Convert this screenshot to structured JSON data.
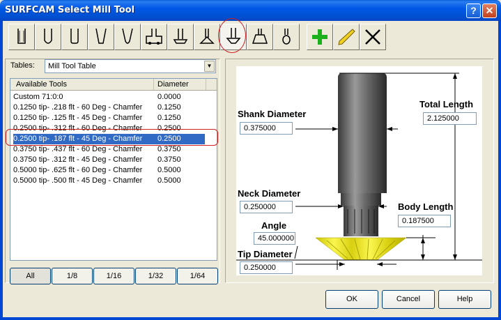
{
  "window": {
    "title": "SURFCAM Select Mill Tool",
    "help_glyph": "?",
    "close_glyph": "✕"
  },
  "toolbar": {
    "tools": [
      "flat-end-mill-icon",
      "ball-end-mill-icon",
      "bull-nose-mill-icon",
      "taper-end-mill-icon",
      "taper-ball-mill-icon",
      "slot-cutter-icon",
      "drill-icon",
      "center-drill-icon",
      "chamfer-mill-icon",
      "dovetail-mill-icon",
      "lollipop-mill-icon",
      "add-tool-icon",
      "edit-tool-icon",
      "delete-tool-icon"
    ],
    "selected_index": 8
  },
  "tables": {
    "label": "Tables:",
    "selected": "Mill Tool Table"
  },
  "tool_list": {
    "headers": [
      "Available Tools",
      "Diameter"
    ],
    "rows": [
      [
        "Custom 71:0:0",
        "0.0000"
      ],
      [
        "0.1250 tip- .218 flt - 60 Deg - Chamfer",
        "0.1250"
      ],
      [
        "0.1250 tip- .125 flt - 45 Deg - Chamfer",
        "0.1250"
      ],
      [
        "0.2500 tip- .312 flt - 60 Deg - Chamfer",
        "0.2500"
      ],
      [
        "0.2500 tip- .187 flt - 45 Deg - Chamfer",
        "0.2500"
      ],
      [
        "0.3750 tip- .437 flt - 60 Deg - Chamfer",
        "0.3750"
      ],
      [
        "0.3750 tip- .312 flt - 45 Deg - Chamfer",
        "0.3750"
      ],
      [
        "0.5000 tip- .625 flt - 60 Deg - Chamfer",
        "0.5000"
      ],
      [
        "0.5000 tip- .500 flt - 45 Deg - Chamfer",
        "0.5000"
      ]
    ],
    "selected_index": 4
  },
  "filters": [
    "All",
    "1/8",
    "1/16",
    "1/32",
    "1/64"
  ],
  "diagram": {
    "shank_diameter_label": "Shank Diameter",
    "shank_diameter": "0.375000",
    "total_length_label": "Total Length",
    "total_length": "2.125000",
    "neck_diameter_label": "Neck Diameter",
    "neck_diameter": "0.250000",
    "body_length_label": "Body Length",
    "body_length": "0.187500",
    "angle_label": "Angle",
    "angle": "45.000000",
    "tip_diameter_label": "Tip Diameter",
    "tip_diameter": "0.250000"
  },
  "buttons": {
    "ok": "OK",
    "cancel": "Cancel",
    "help": "Help"
  },
  "colors": {
    "title_bar": "#0054e3",
    "selection": "#316ac5",
    "cutter_yellow": "#f2ec2e",
    "highlight_red": "#d02020"
  }
}
